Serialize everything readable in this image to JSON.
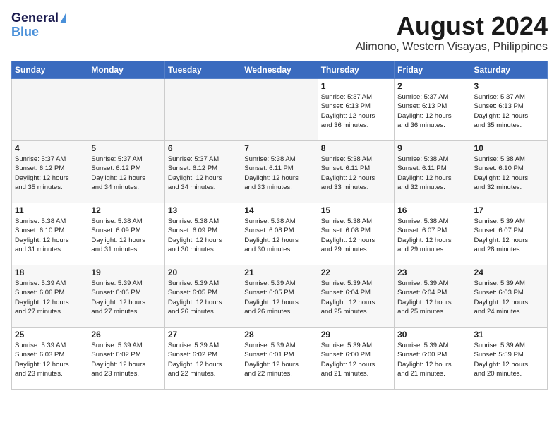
{
  "header": {
    "logo_line1": "General",
    "logo_line2": "Blue",
    "month_year": "August 2024",
    "location": "Alimono, Western Visayas, Philippines"
  },
  "weekdays": [
    "Sunday",
    "Monday",
    "Tuesday",
    "Wednesday",
    "Thursday",
    "Friday",
    "Saturday"
  ],
  "weeks": [
    [
      {
        "day": "",
        "info": "",
        "empty": true
      },
      {
        "day": "",
        "info": "",
        "empty": true
      },
      {
        "day": "",
        "info": "",
        "empty": true
      },
      {
        "day": "",
        "info": "",
        "empty": true
      },
      {
        "day": "1",
        "info": "Sunrise: 5:37 AM\nSunset: 6:13 PM\nDaylight: 12 hours\nand 36 minutes.",
        "empty": false
      },
      {
        "day": "2",
        "info": "Sunrise: 5:37 AM\nSunset: 6:13 PM\nDaylight: 12 hours\nand 36 minutes.",
        "empty": false
      },
      {
        "day": "3",
        "info": "Sunrise: 5:37 AM\nSunset: 6:13 PM\nDaylight: 12 hours\nand 35 minutes.",
        "empty": false
      }
    ],
    [
      {
        "day": "4",
        "info": "Sunrise: 5:37 AM\nSunset: 6:12 PM\nDaylight: 12 hours\nand 35 minutes.",
        "empty": false
      },
      {
        "day": "5",
        "info": "Sunrise: 5:37 AM\nSunset: 6:12 PM\nDaylight: 12 hours\nand 34 minutes.",
        "empty": false
      },
      {
        "day": "6",
        "info": "Sunrise: 5:37 AM\nSunset: 6:12 PM\nDaylight: 12 hours\nand 34 minutes.",
        "empty": false
      },
      {
        "day": "7",
        "info": "Sunrise: 5:38 AM\nSunset: 6:11 PM\nDaylight: 12 hours\nand 33 minutes.",
        "empty": false
      },
      {
        "day": "8",
        "info": "Sunrise: 5:38 AM\nSunset: 6:11 PM\nDaylight: 12 hours\nand 33 minutes.",
        "empty": false
      },
      {
        "day": "9",
        "info": "Sunrise: 5:38 AM\nSunset: 6:11 PM\nDaylight: 12 hours\nand 32 minutes.",
        "empty": false
      },
      {
        "day": "10",
        "info": "Sunrise: 5:38 AM\nSunset: 6:10 PM\nDaylight: 12 hours\nand 32 minutes.",
        "empty": false
      }
    ],
    [
      {
        "day": "11",
        "info": "Sunrise: 5:38 AM\nSunset: 6:10 PM\nDaylight: 12 hours\nand 31 minutes.",
        "empty": false
      },
      {
        "day": "12",
        "info": "Sunrise: 5:38 AM\nSunset: 6:09 PM\nDaylight: 12 hours\nand 31 minutes.",
        "empty": false
      },
      {
        "day": "13",
        "info": "Sunrise: 5:38 AM\nSunset: 6:09 PM\nDaylight: 12 hours\nand 30 minutes.",
        "empty": false
      },
      {
        "day": "14",
        "info": "Sunrise: 5:38 AM\nSunset: 6:08 PM\nDaylight: 12 hours\nand 30 minutes.",
        "empty": false
      },
      {
        "day": "15",
        "info": "Sunrise: 5:38 AM\nSunset: 6:08 PM\nDaylight: 12 hours\nand 29 minutes.",
        "empty": false
      },
      {
        "day": "16",
        "info": "Sunrise: 5:38 AM\nSunset: 6:07 PM\nDaylight: 12 hours\nand 29 minutes.",
        "empty": false
      },
      {
        "day": "17",
        "info": "Sunrise: 5:39 AM\nSunset: 6:07 PM\nDaylight: 12 hours\nand 28 minutes.",
        "empty": false
      }
    ],
    [
      {
        "day": "18",
        "info": "Sunrise: 5:39 AM\nSunset: 6:06 PM\nDaylight: 12 hours\nand 27 minutes.",
        "empty": false
      },
      {
        "day": "19",
        "info": "Sunrise: 5:39 AM\nSunset: 6:06 PM\nDaylight: 12 hours\nand 27 minutes.",
        "empty": false
      },
      {
        "day": "20",
        "info": "Sunrise: 5:39 AM\nSunset: 6:05 PM\nDaylight: 12 hours\nand 26 minutes.",
        "empty": false
      },
      {
        "day": "21",
        "info": "Sunrise: 5:39 AM\nSunset: 6:05 PM\nDaylight: 12 hours\nand 26 minutes.",
        "empty": false
      },
      {
        "day": "22",
        "info": "Sunrise: 5:39 AM\nSunset: 6:04 PM\nDaylight: 12 hours\nand 25 minutes.",
        "empty": false
      },
      {
        "day": "23",
        "info": "Sunrise: 5:39 AM\nSunset: 6:04 PM\nDaylight: 12 hours\nand 25 minutes.",
        "empty": false
      },
      {
        "day": "24",
        "info": "Sunrise: 5:39 AM\nSunset: 6:03 PM\nDaylight: 12 hours\nand 24 minutes.",
        "empty": false
      }
    ],
    [
      {
        "day": "25",
        "info": "Sunrise: 5:39 AM\nSunset: 6:03 PM\nDaylight: 12 hours\nand 23 minutes.",
        "empty": false
      },
      {
        "day": "26",
        "info": "Sunrise: 5:39 AM\nSunset: 6:02 PM\nDaylight: 12 hours\nand 23 minutes.",
        "empty": false
      },
      {
        "day": "27",
        "info": "Sunrise: 5:39 AM\nSunset: 6:02 PM\nDaylight: 12 hours\nand 22 minutes.",
        "empty": false
      },
      {
        "day": "28",
        "info": "Sunrise: 5:39 AM\nSunset: 6:01 PM\nDaylight: 12 hours\nand 22 minutes.",
        "empty": false
      },
      {
        "day": "29",
        "info": "Sunrise: 5:39 AM\nSunset: 6:00 PM\nDaylight: 12 hours\nand 21 minutes.",
        "empty": false
      },
      {
        "day": "30",
        "info": "Sunrise: 5:39 AM\nSunset: 6:00 PM\nDaylight: 12 hours\nand 21 minutes.",
        "empty": false
      },
      {
        "day": "31",
        "info": "Sunrise: 5:39 AM\nSunset: 5:59 PM\nDaylight: 12 hours\nand 20 minutes.",
        "empty": false
      }
    ]
  ]
}
